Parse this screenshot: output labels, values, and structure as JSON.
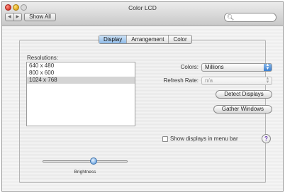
{
  "window": {
    "title": "Color LCD"
  },
  "toolbar": {
    "nav_back": "◀",
    "nav_forward": "▶",
    "show_all_label": "Show All",
    "search_placeholder": ""
  },
  "tabs": [
    {
      "label": "Display",
      "active": true
    },
    {
      "label": "Arrangement",
      "active": false
    },
    {
      "label": "Color",
      "active": false
    }
  ],
  "resolutions": {
    "label": "Resolutions:",
    "items": [
      "640 x 480",
      "800 x 600",
      "1024 x 768"
    ],
    "selected_index": 2
  },
  "colors": {
    "label": "Colors:",
    "value": "Millions"
  },
  "refresh_rate": {
    "label": "Refresh Rate:",
    "value": "n/a"
  },
  "buttons": {
    "detect_displays": "Detect Displays",
    "gather_windows": "Gather Windows"
  },
  "menu_bar_option": {
    "label": "Show displays in menu bar",
    "checked": false
  },
  "help": {
    "label": "?"
  },
  "brightness": {
    "label": "Brightness",
    "level": 0.6
  },
  "colors_theme": {
    "selected_tab": "#8fbbe8",
    "slider_knob": "#6fa7e0",
    "help_glyph": "#5b2aa8"
  }
}
